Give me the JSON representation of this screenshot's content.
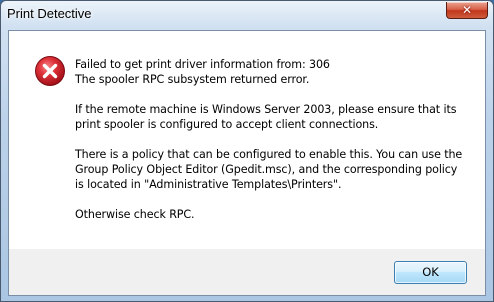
{
  "window": {
    "title": "Print Detective",
    "close_glyph": "✕"
  },
  "message": {
    "lines": [
      "Failed to get print driver information from: 306",
      "The spooler RPC subsystem returned error.",
      "If the remote machine is Windows Server 2003, please ensure that its",
      "print spooler is configured to accept client connections.",
      "There is a policy that can be configured to enable this. You can use the",
      "Group Policy Object Editor (Gpedit.msc), and the corresponding policy",
      "is located in \"Administrative Templates\\Printers\".",
      "Otherwise check RPC."
    ]
  },
  "icon": {
    "name": "error-icon",
    "color": "#d4202a"
  },
  "buttons": {
    "ok_label": "OK"
  }
}
